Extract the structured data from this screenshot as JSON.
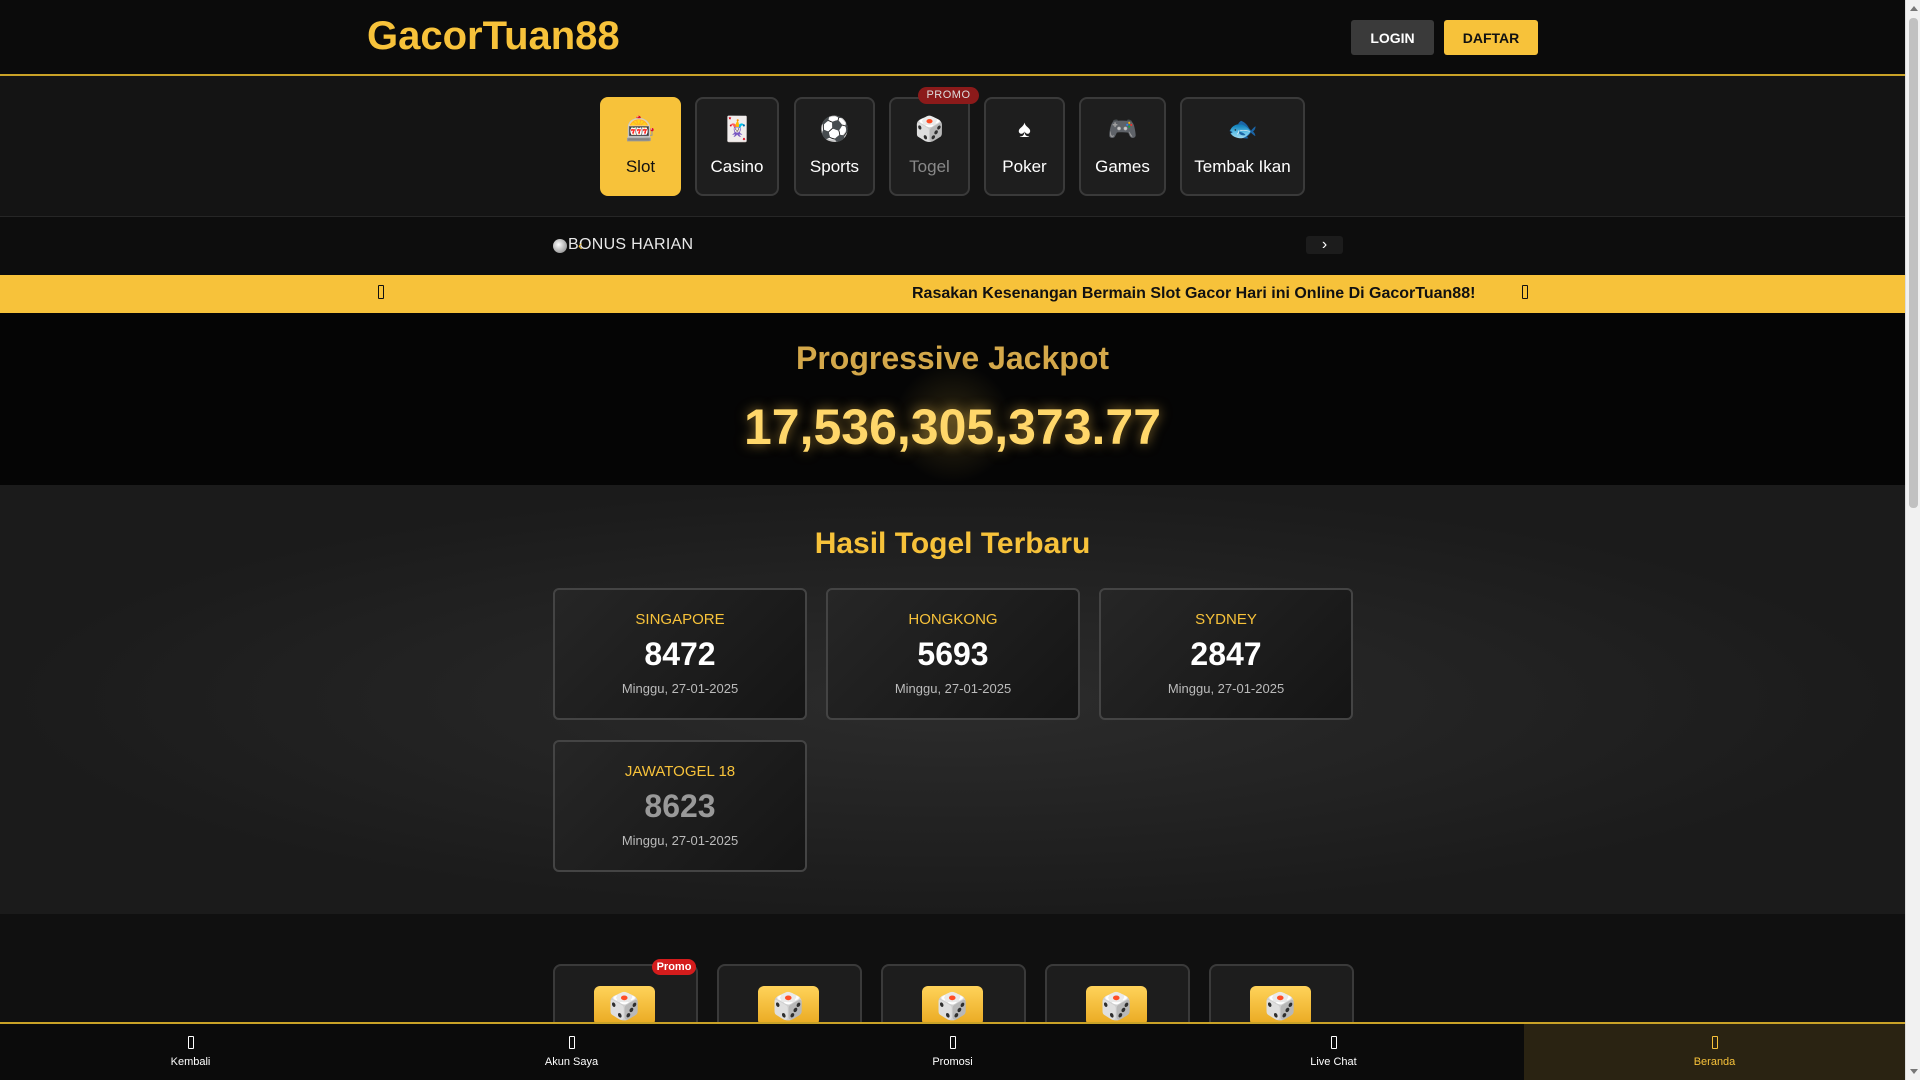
{
  "header": {
    "logo": "GacorTuan88",
    "login_label": "LOGIN",
    "register_label": "DAFTAR"
  },
  "categories": [
    {
      "label": "Slot",
      "icon": "slot-machine-icon",
      "glyph": "🎰",
      "active": true
    },
    {
      "label": "Casino",
      "icon": "playing-card-icon",
      "glyph": "🃏"
    },
    {
      "label": "Sports",
      "icon": "soccer-ball-icon",
      "glyph": "⚽"
    },
    {
      "label": "Togel",
      "icon": "dice-icon",
      "glyph": "🎲",
      "badge": "PROMO"
    },
    {
      "label": "Poker",
      "icon": "spade-icon",
      "glyph": "♠"
    },
    {
      "label": "Games",
      "icon": "gamepad-icon",
      "glyph": "🎮"
    },
    {
      "label": "Tembak Ikan",
      "icon": "fish-icon",
      "glyph": "🐟"
    }
  ],
  "bonus": {
    "text": "BONUS HARIAN",
    "prev": "‹",
    "next": "›"
  },
  "marquee": {
    "text": "Rasakan Kesenangan Bermain Slot Gacor Hari ini Online Di GacorTuan88!"
  },
  "jackpot": {
    "title": "Progressive Jackpot",
    "value": "17,536,305,373.77"
  },
  "results": {
    "title": "Hasil Togel Terbaru",
    "items": [
      {
        "market": "SINGAPORE",
        "number": "8472",
        "date": "Minggu, 27-01-2025"
      },
      {
        "market": "HONGKONG",
        "number": "5693",
        "date": "Minggu, 27-01-2025"
      },
      {
        "market": "SYDNEY",
        "number": "2847",
        "date": "Minggu, 27-01-2025"
      },
      {
        "market": "JAWATOGEL 18",
        "number": "8623",
        "date": "Minggu, 27-01-2025"
      }
    ]
  },
  "game_tiles": {
    "promo_badge": "Promo",
    "icon": "dice-icon",
    "glyph": "🎲"
  },
  "bottom_nav": [
    {
      "label": "Kembali",
      "icon": "back-icon"
    },
    {
      "label": "Akun Saya",
      "icon": "account-icon"
    },
    {
      "label": "Promosi",
      "icon": "promo-icon"
    },
    {
      "label": "Live Chat",
      "icon": "chat-icon"
    },
    {
      "label": "Beranda",
      "icon": "home-icon",
      "active": true
    }
  ],
  "colors": {
    "accent": "#f7c23a",
    "background": "#0a0a0a",
    "promo_red": "#d41c1c"
  }
}
